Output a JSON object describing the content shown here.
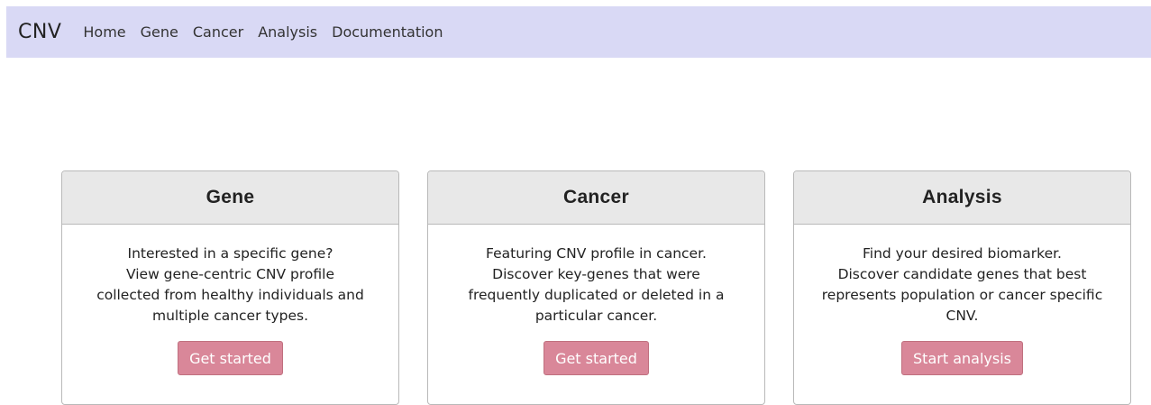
{
  "navbar": {
    "brand": "CNV",
    "links": [
      "Home",
      "Gene",
      "Cancer",
      "Analysis",
      "Documentation"
    ]
  },
  "cards": [
    {
      "title": "Gene",
      "lines": [
        "Interested in a specific gene?",
        "View gene-centric CNV profile",
        "collected from healthy individuals and",
        "multiple cancer types."
      ],
      "button": "Get started"
    },
    {
      "title": "Cancer",
      "lines": [
        "Featuring CNV profile in cancer.",
        "Discover key-genes that were",
        "frequently duplicated or deleted in a",
        "particular cancer."
      ],
      "button": "Get started"
    },
    {
      "title": "Analysis",
      "lines": [
        "Find your desired biomarker.",
        "Discover candidate genes that best",
        "represents population or cancer specific",
        "CNV."
      ],
      "button": "Start analysis"
    }
  ],
  "colors": {
    "navbar_bg": "#d9d9f5",
    "card_header_bg": "#e8e8e8",
    "button_bg": "#d98799"
  }
}
